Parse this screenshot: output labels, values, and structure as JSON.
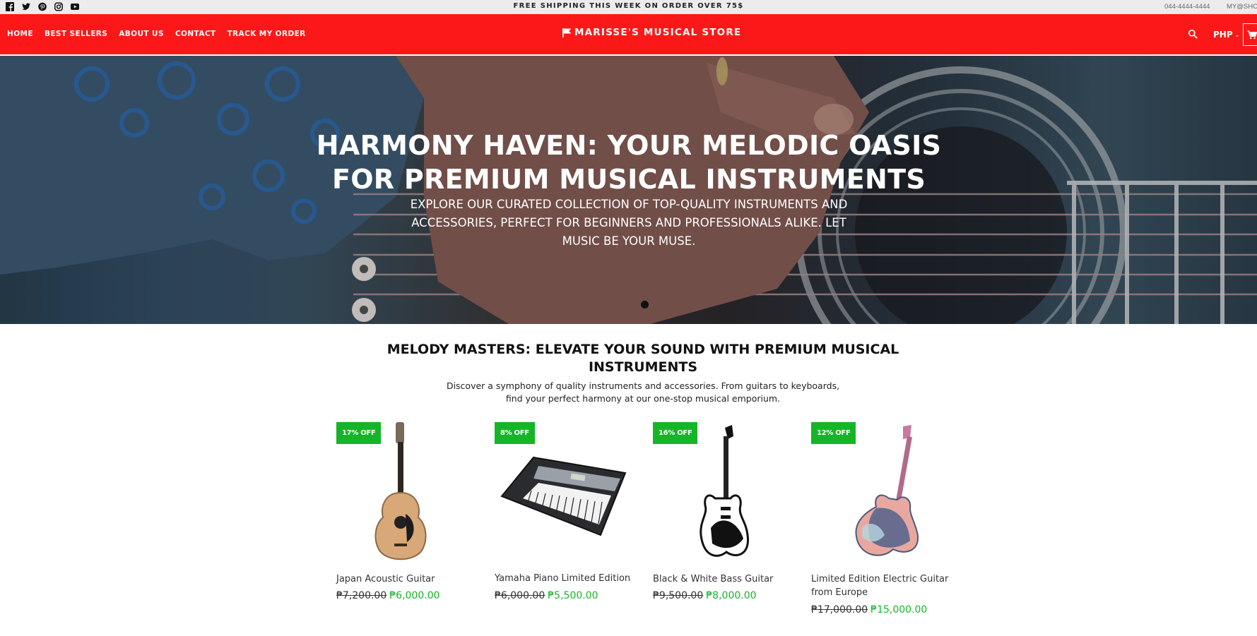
{
  "topbar": {
    "social": [
      "facebook-icon",
      "twitter-icon",
      "pinterest-icon",
      "instagram-icon",
      "youtube-icon"
    ],
    "announcement": "FREE SHIPPING THIS WEEK ON ORDER OVER 75$",
    "phone": "044-4444-4444",
    "email": "MY@SHOP"
  },
  "header": {
    "nav": [
      "HOME",
      "BEST SELLERS",
      "ABOUT US",
      "CONTACT",
      "TRACK MY ORDER"
    ],
    "store_name": "MARISSE'S MUSICAL STORE",
    "currency": "PHP",
    "accent_color": "#fc1819"
  },
  "hero": {
    "title": "HARMONY HAVEN: YOUR MELODIC OASIS FOR PREMIUM MUSICAL INSTRUMENTS",
    "subtitle": "EXPLORE OUR CURATED COLLECTION OF TOP-QUALITY INSTRUMENTS AND ACCESSORIES, PERFECT FOR BEGINNERS AND PROFESSIONALS ALIKE. LET MUSIC BE YOUR MUSE."
  },
  "section": {
    "title": "MELODY MASTERS: ELEVATE YOUR SOUND WITH PREMIUM MUSICAL INSTRUMENTS",
    "description": "Discover a symphony of quality instruments and accessories. From guitars to keyboards, find your perfect harmony at our one-stop musical emporium."
  },
  "products": [
    {
      "badge": "17% OFF",
      "name": "Japan Acoustic Guitar",
      "old_price": "₱7,200.00",
      "new_price": "₱6,000.00",
      "image": "acoustic-guitar-icon"
    },
    {
      "badge": "8% OFF",
      "name": "Yamaha Piano Limited Edition",
      "old_price": "₱6,000.00",
      "new_price": "₱5,500.00",
      "image": "keyboard-icon"
    },
    {
      "badge": "16% OFF",
      "name": "Black & White Bass Guitar",
      "old_price": "₱9,500.00",
      "new_price": "₱8,000.00",
      "image": "bass-guitar-icon"
    },
    {
      "badge": "12% OFF",
      "name": "Limited Edition Electric Guitar from Europe",
      "old_price": "₱17,000.00",
      "new_price": "₱15,000.00",
      "image": "electric-guitar-icon"
    }
  ],
  "colors": {
    "sale_green": "#16b527",
    "header_red": "#fc1819"
  }
}
